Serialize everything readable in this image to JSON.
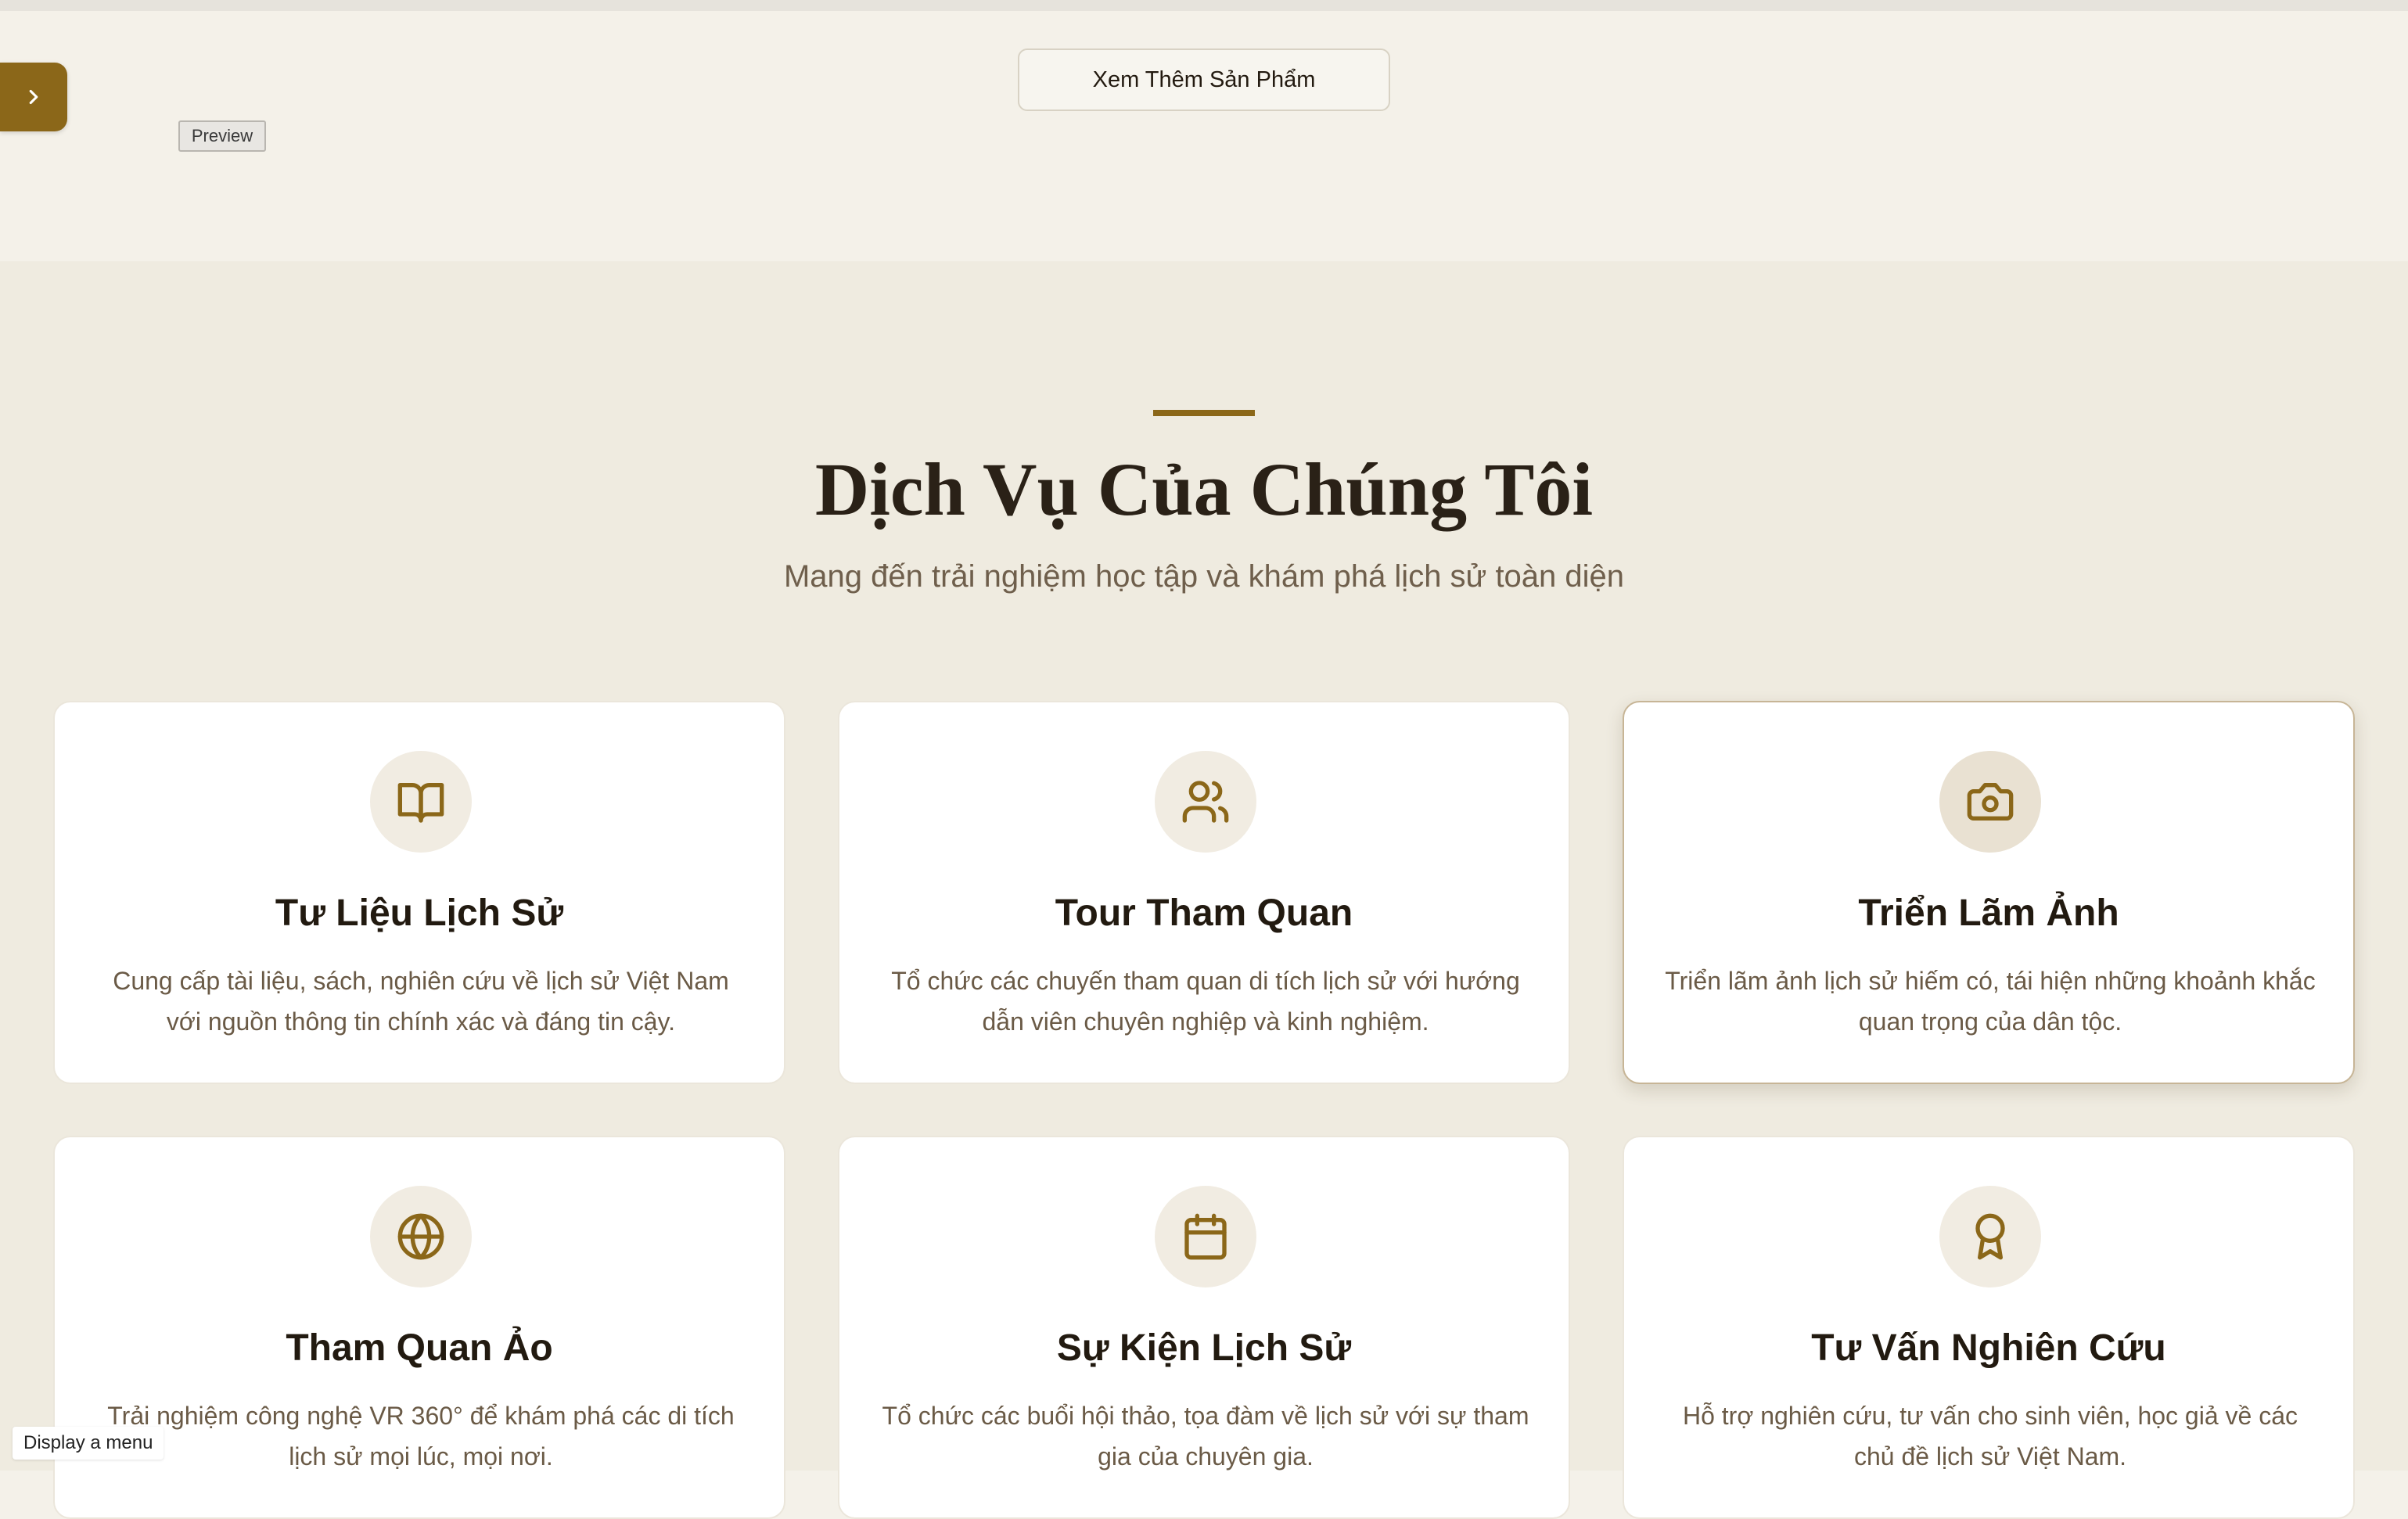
{
  "more_products_button": "Xem Thêm Sản Phẩm",
  "preview_tag": "Preview",
  "menu_hint": "Display a menu",
  "services": {
    "title": "Dịch Vụ Của Chúng Tôi",
    "subtitle": "Mang đến trải nghiệm học tập và khám phá lịch sử toàn diện",
    "items": [
      {
        "icon": "book-open-icon",
        "title": "Tư Liệu Lịch Sử",
        "description": "Cung cấp tài liệu, sách, nghiên cứu về lịch sử Việt Nam với nguồn thông tin chính xác và đáng tin cậy."
      },
      {
        "icon": "users-icon",
        "title": "Tour Tham Quan",
        "description": "Tổ chức các chuyến tham quan di tích lịch sử với hướng dẫn viên chuyên nghiệp và kinh nghiệm."
      },
      {
        "icon": "camera-icon",
        "title": "Triển Lãm Ảnh",
        "description": "Triển lãm ảnh lịch sử hiếm có, tái hiện những khoảnh khắc quan trọng của dân tộc."
      },
      {
        "icon": "globe-icon",
        "title": "Tham Quan Ảo",
        "description": "Trải nghiệm công nghệ VR 360° để khám phá các di tích lịch sử mọi lúc, mọi nơi."
      },
      {
        "icon": "calendar-icon",
        "title": "Sự Kiện Lịch Sử",
        "description": "Tổ chức các buổi hội thảo, tọa đàm về lịch sử với sự tham gia của chuyên gia."
      },
      {
        "icon": "award-icon",
        "title": "Tư Vấn Nghiên Cứu",
        "description": "Hỗ trợ nghiên cứu, tư vấn cho sinh viên, học giả về các chủ đề lịch sử Việt Nam."
      }
    ]
  },
  "colors": {
    "accent": "#8b6719",
    "page_background": "#f4f1e9",
    "section_background": "#efebe0",
    "card_background": "#ffffff"
  }
}
